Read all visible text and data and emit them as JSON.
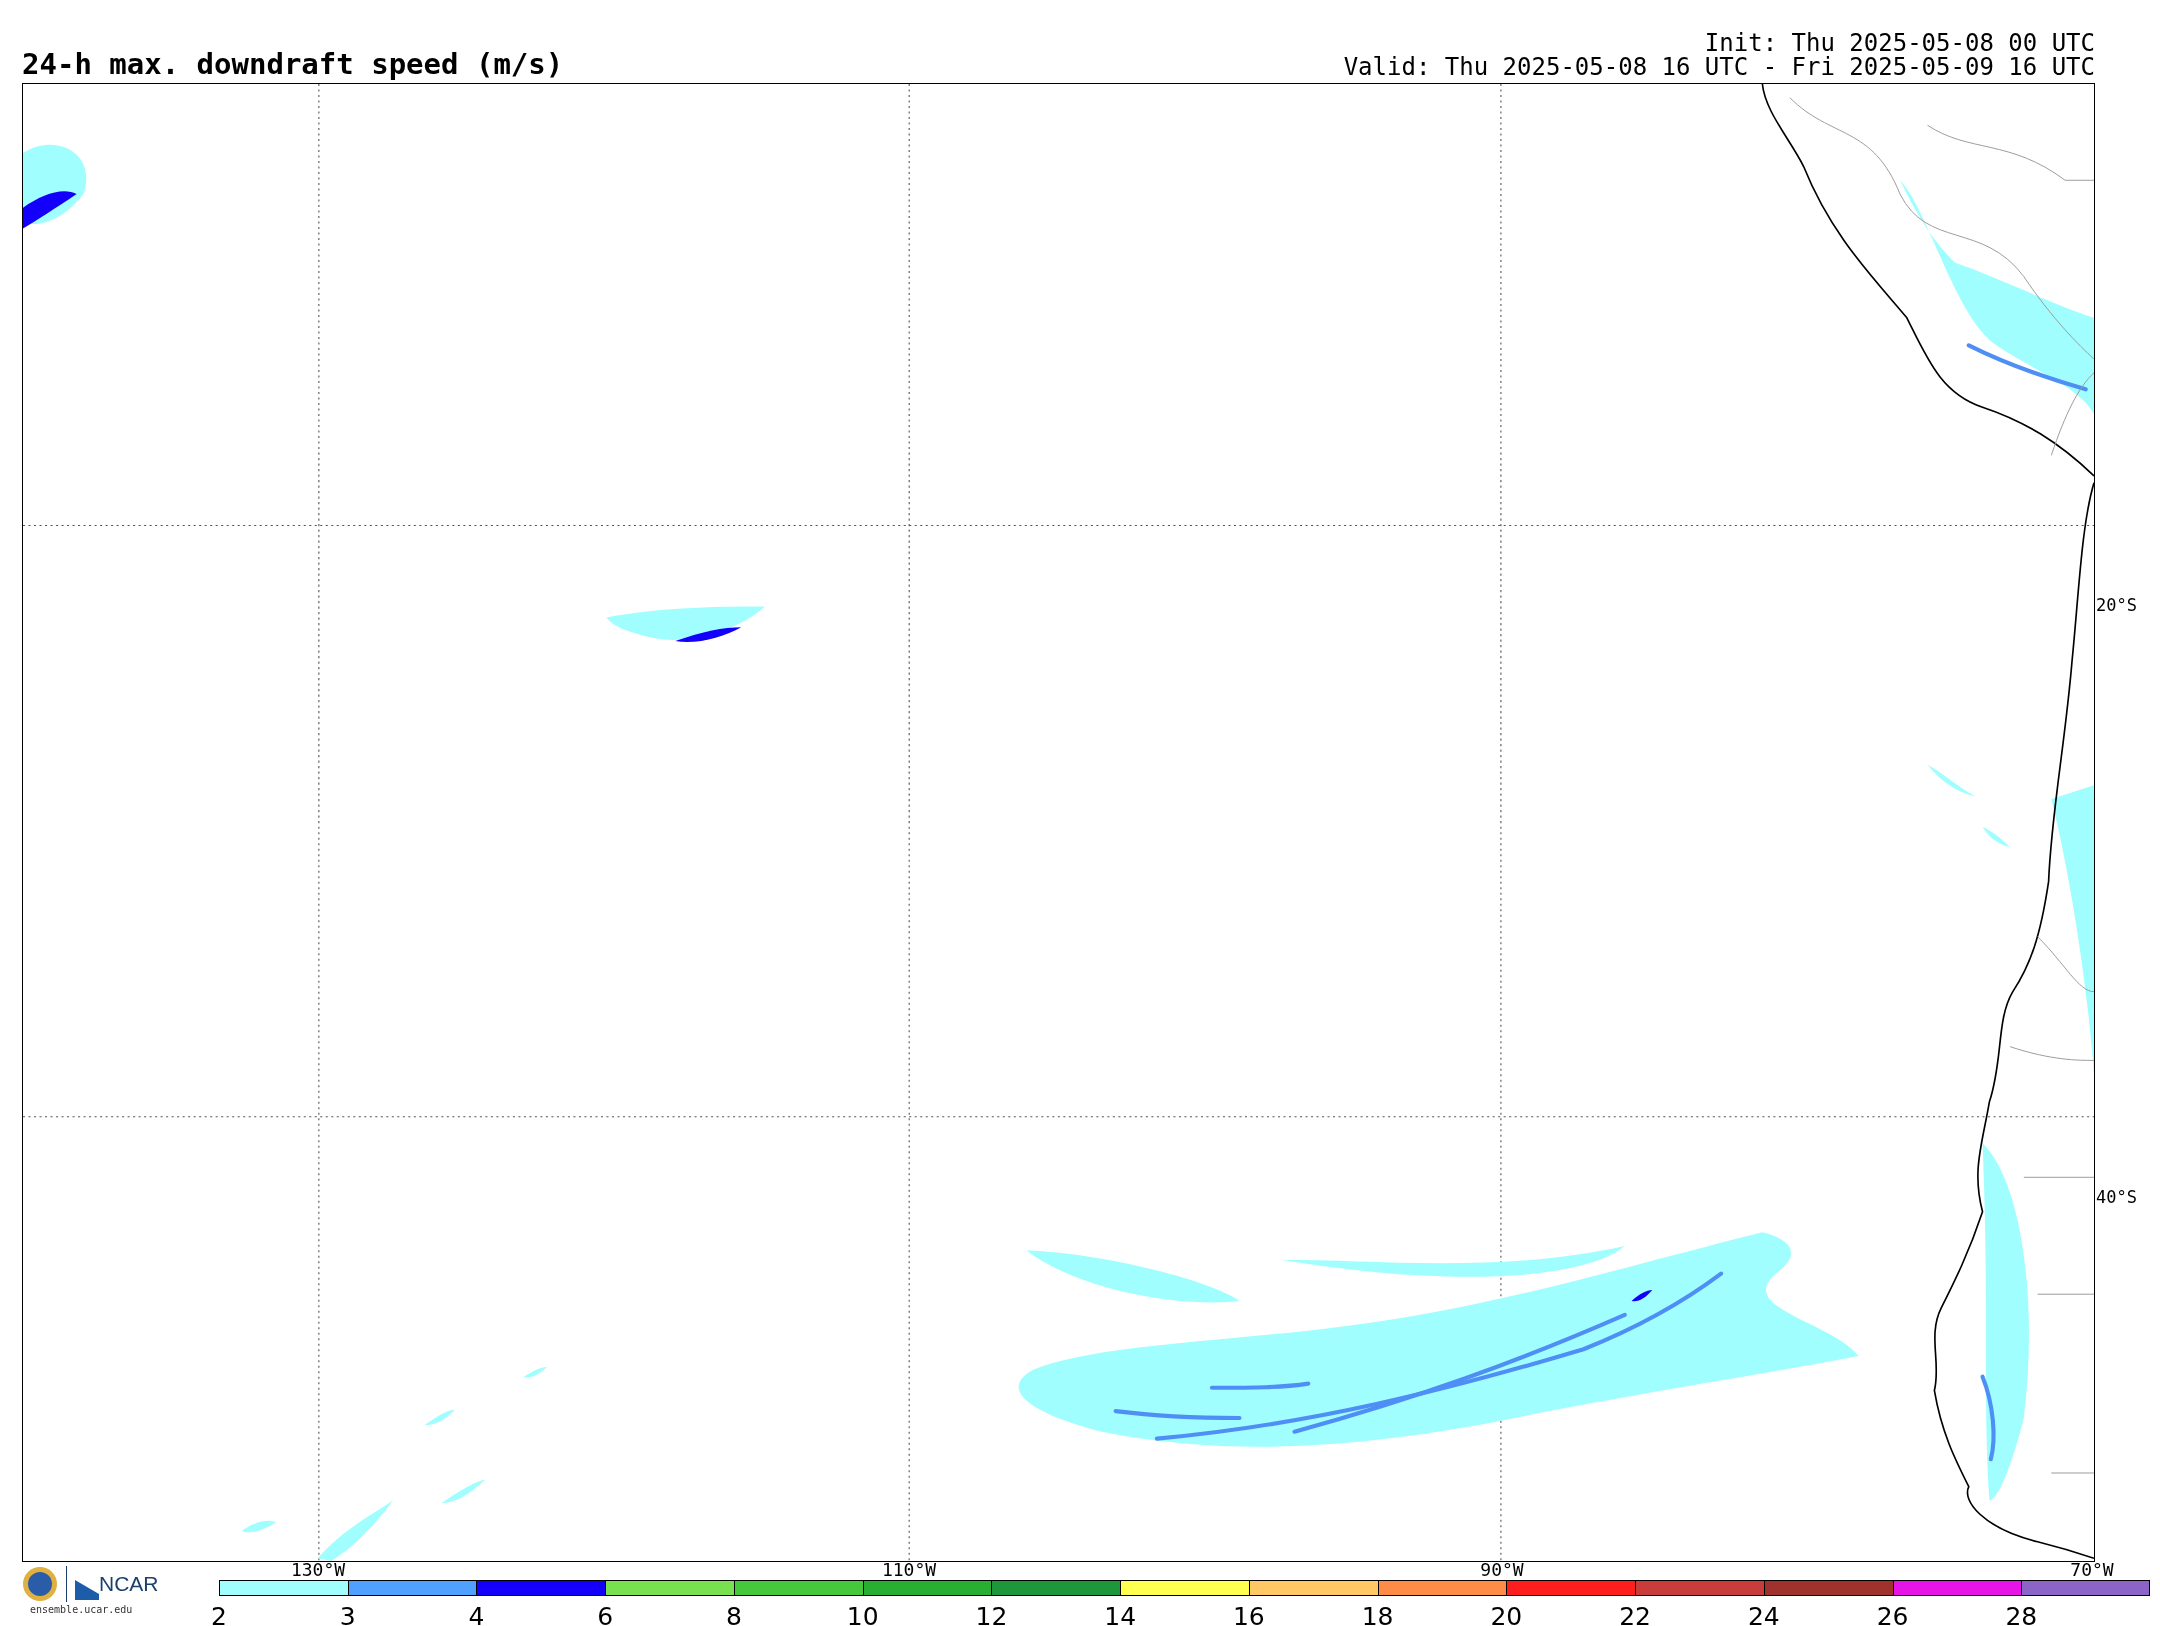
{
  "title": "24-h max. downdraft speed (m/s)",
  "init": "Init: Thu 2025-05-08 00 UTC",
  "valid": "Valid: Thu 2025-05-08 16 UTC - Fri 2025-05-09 16 UTC",
  "lat_labels": [
    "20°S",
    "40°S"
  ],
  "lon_labels": [
    "130°W",
    "110°W",
    "90°W",
    "70°W"
  ],
  "logo": {
    "name": "NCAR",
    "site": "ensemble.ucar.edu"
  },
  "colorbar": [
    {
      "label": "2",
      "color": "#a0fffe"
    },
    {
      "label": "3",
      "color": "#50a0ff"
    },
    {
      "label": "4",
      "color": "#1400fa"
    },
    {
      "label": "6",
      "color": "#78e150"
    },
    {
      "label": "8",
      "color": "#46c83c"
    },
    {
      "label": "10",
      "color": "#28af32"
    },
    {
      "label": "12",
      "color": "#1e963c"
    },
    {
      "label": "14",
      "color": "#ffff50"
    },
    {
      "label": "16",
      "color": "#ffc864"
    },
    {
      "label": "18",
      "color": "#ff8c46"
    },
    {
      "label": "20",
      "color": "#ff1e1e"
    },
    {
      "label": "22",
      "color": "#c83c3c"
    },
    {
      "label": "24",
      "color": "#a0322d"
    },
    {
      "label": "26",
      "color": "#e614e6"
    },
    {
      "label": "28",
      "color": "#8c64c8"
    }
  ]
}
